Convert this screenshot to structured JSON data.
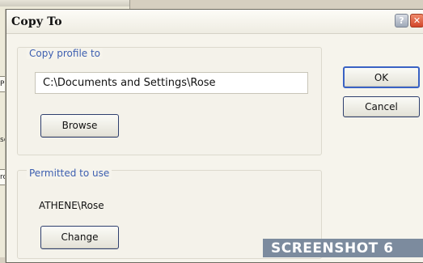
{
  "background": {
    "fragments": [
      "Pr",
      "se",
      "ro"
    ]
  },
  "dialog": {
    "title": "Copy To",
    "help_glyph": "?",
    "close_glyph": "✕",
    "copy_group": {
      "label": "Copy profile to",
      "path_value": "C:\\Documents and Settings\\Rose",
      "browse_label": "Browse"
    },
    "permitted_group": {
      "label": "Permitted to use",
      "user_value": "ATHENE\\Rose",
      "change_label": "Change"
    },
    "ok_label": "OK",
    "cancel_label": "Cancel"
  },
  "caption": "SCREENSHOT 6",
  "colors": {
    "group_label": "#3d5fb0",
    "default_button_border": "#3a62c4",
    "close_button": "#d2472b",
    "caption_banner": "#7c8b9e"
  }
}
